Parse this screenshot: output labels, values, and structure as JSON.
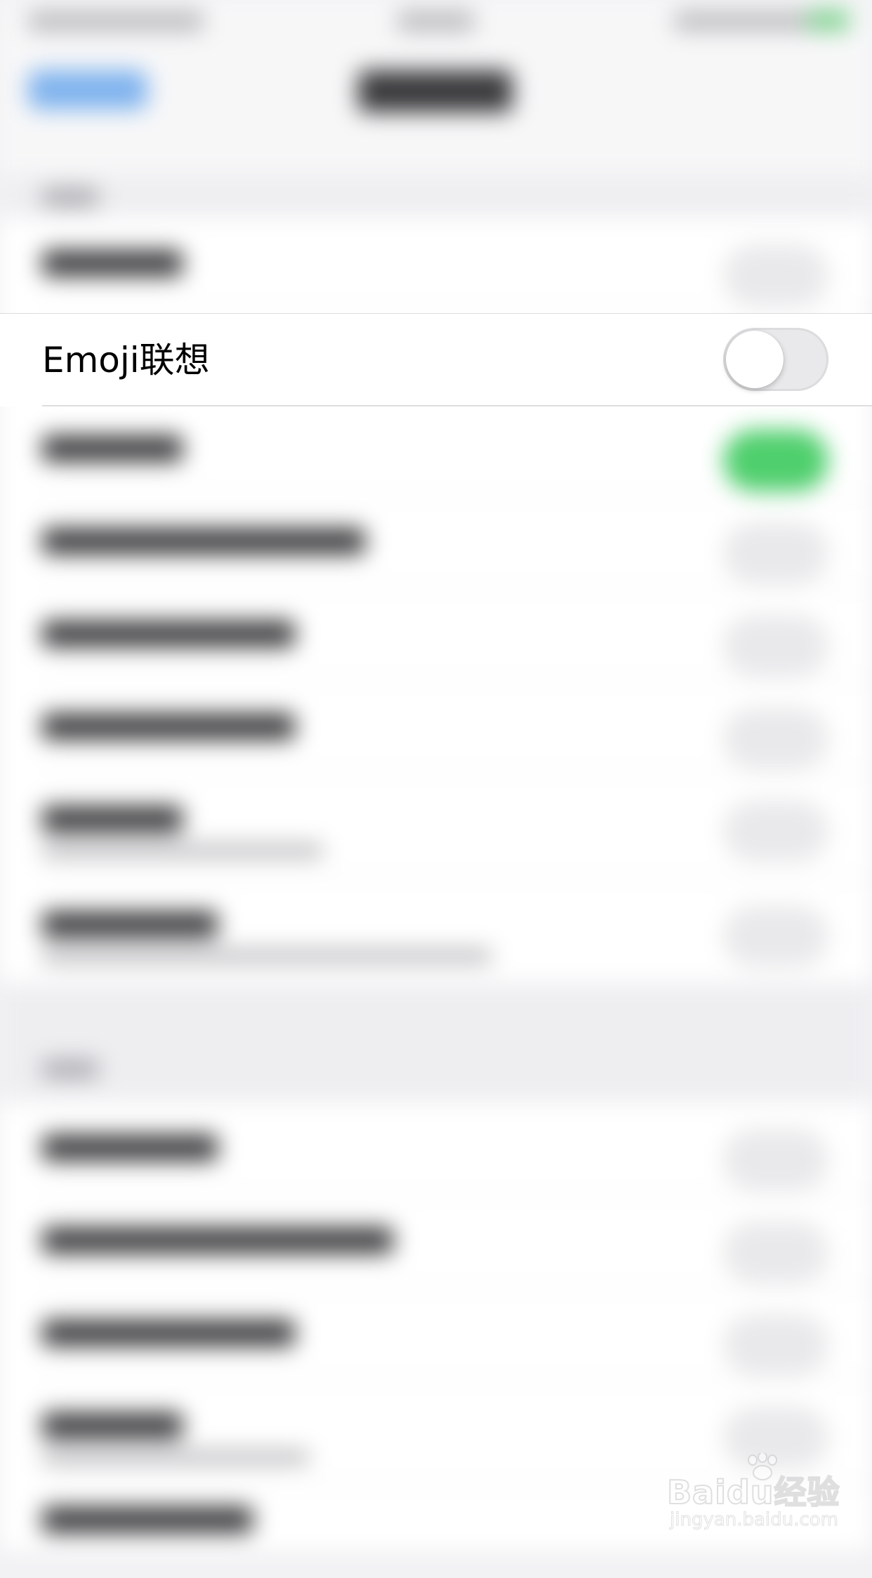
{
  "focused_setting": {
    "label": "Emoji联想",
    "toggle_on": false
  },
  "watermark": {
    "brand": "Baidu经验",
    "url": "jingyan.baidu.com"
  },
  "colors": {
    "toggle_off_track": "#e9e9eb",
    "toggle_on_track": "#4fcf6d",
    "nav_back_blue": "#7fb3ee",
    "background": "#f2f2f4"
  }
}
